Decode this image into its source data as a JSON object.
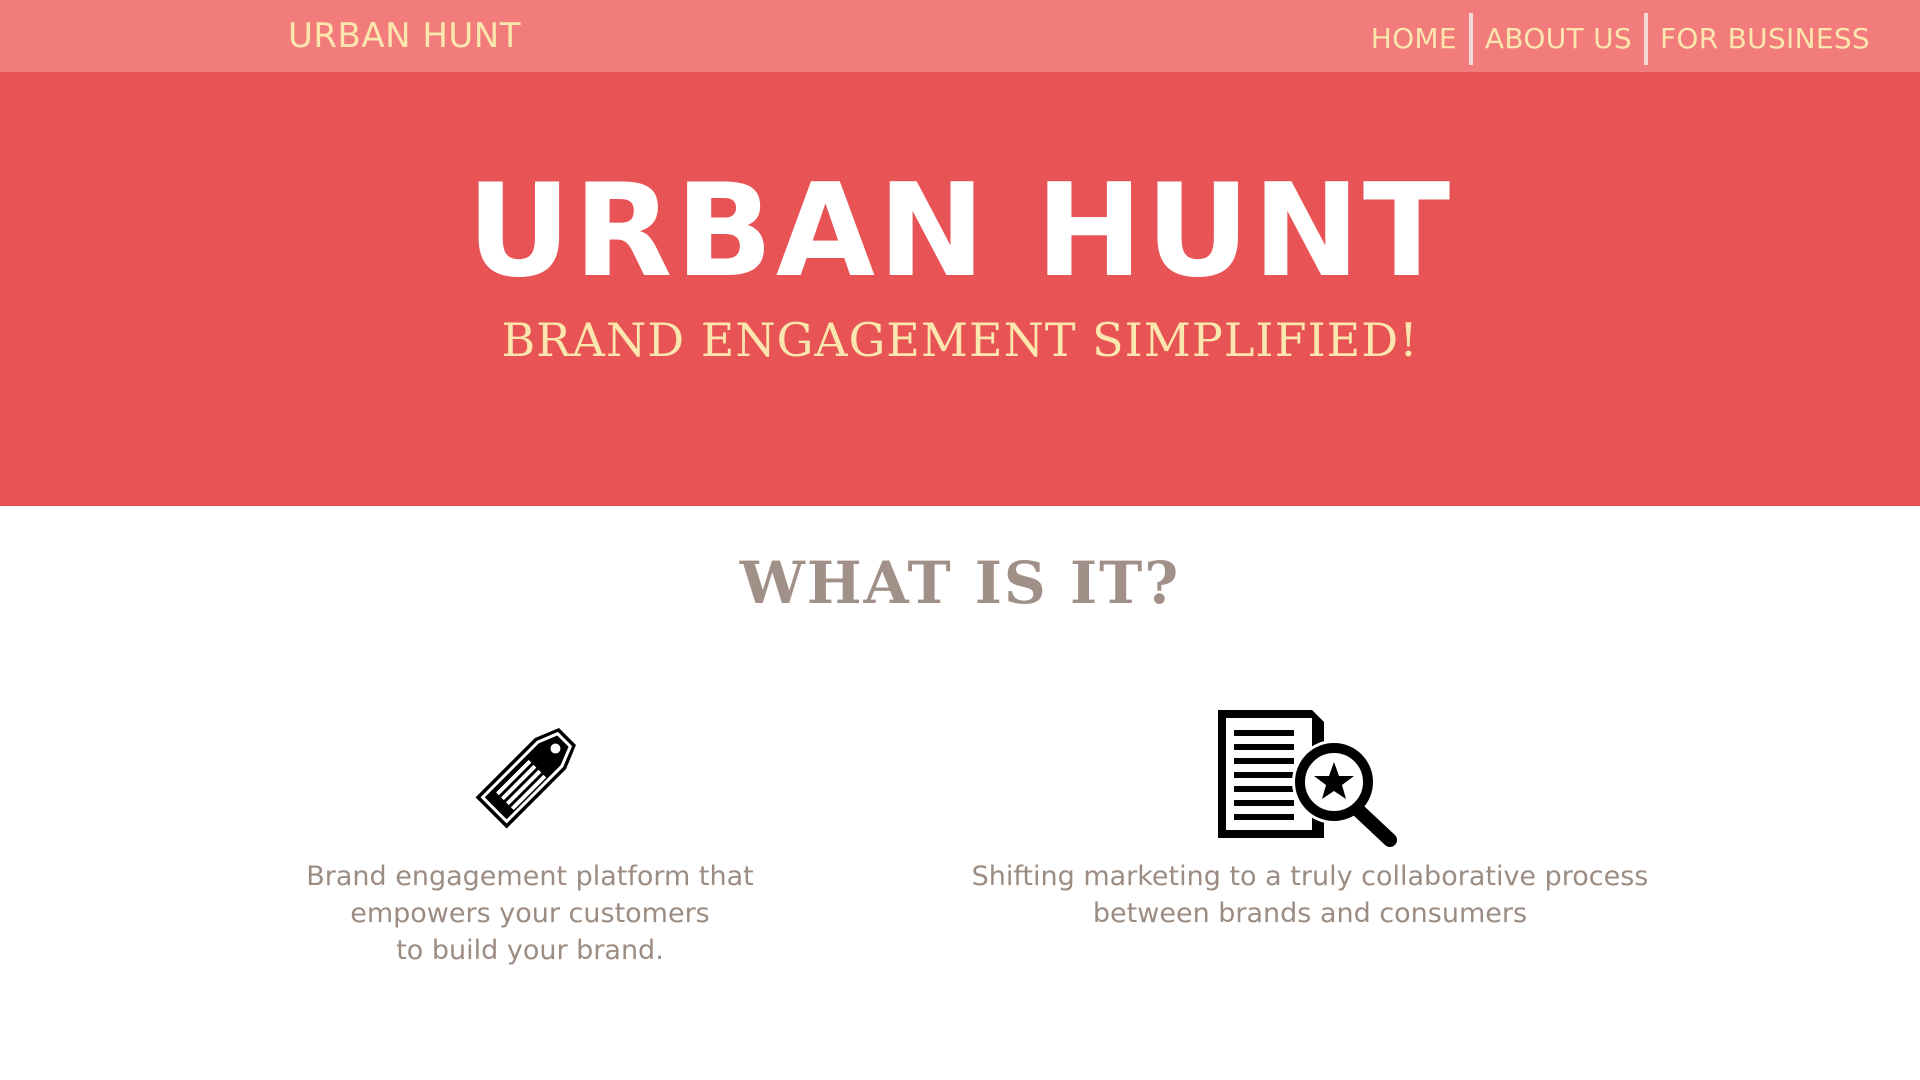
{
  "header": {
    "brand": "URBAN HUNT",
    "nav": [
      {
        "label": "HOME"
      },
      {
        "label": "ABOUT US"
      },
      {
        "label": "FOR BUSINESS"
      }
    ]
  },
  "hero": {
    "title": "URBAN HUNT",
    "tagline": "BRAND ENGAGEMENT SIMPLIFIED!"
  },
  "about": {
    "title": "WHAT IS IT?",
    "features": [
      {
        "icon": "price-tag-icon",
        "text": "Brand engagement platform that\nempowers your customers\nto build your brand."
      },
      {
        "icon": "document-search-icon",
        "text": "Shifting marketing to a truly collaborative process\nbetween brands and consumers"
      }
    ]
  },
  "colors": {
    "topbar": "#f27b7b",
    "hero": "#e85456",
    "accent_text": "#fbe7ae",
    "body_text": "#9c8c82"
  }
}
